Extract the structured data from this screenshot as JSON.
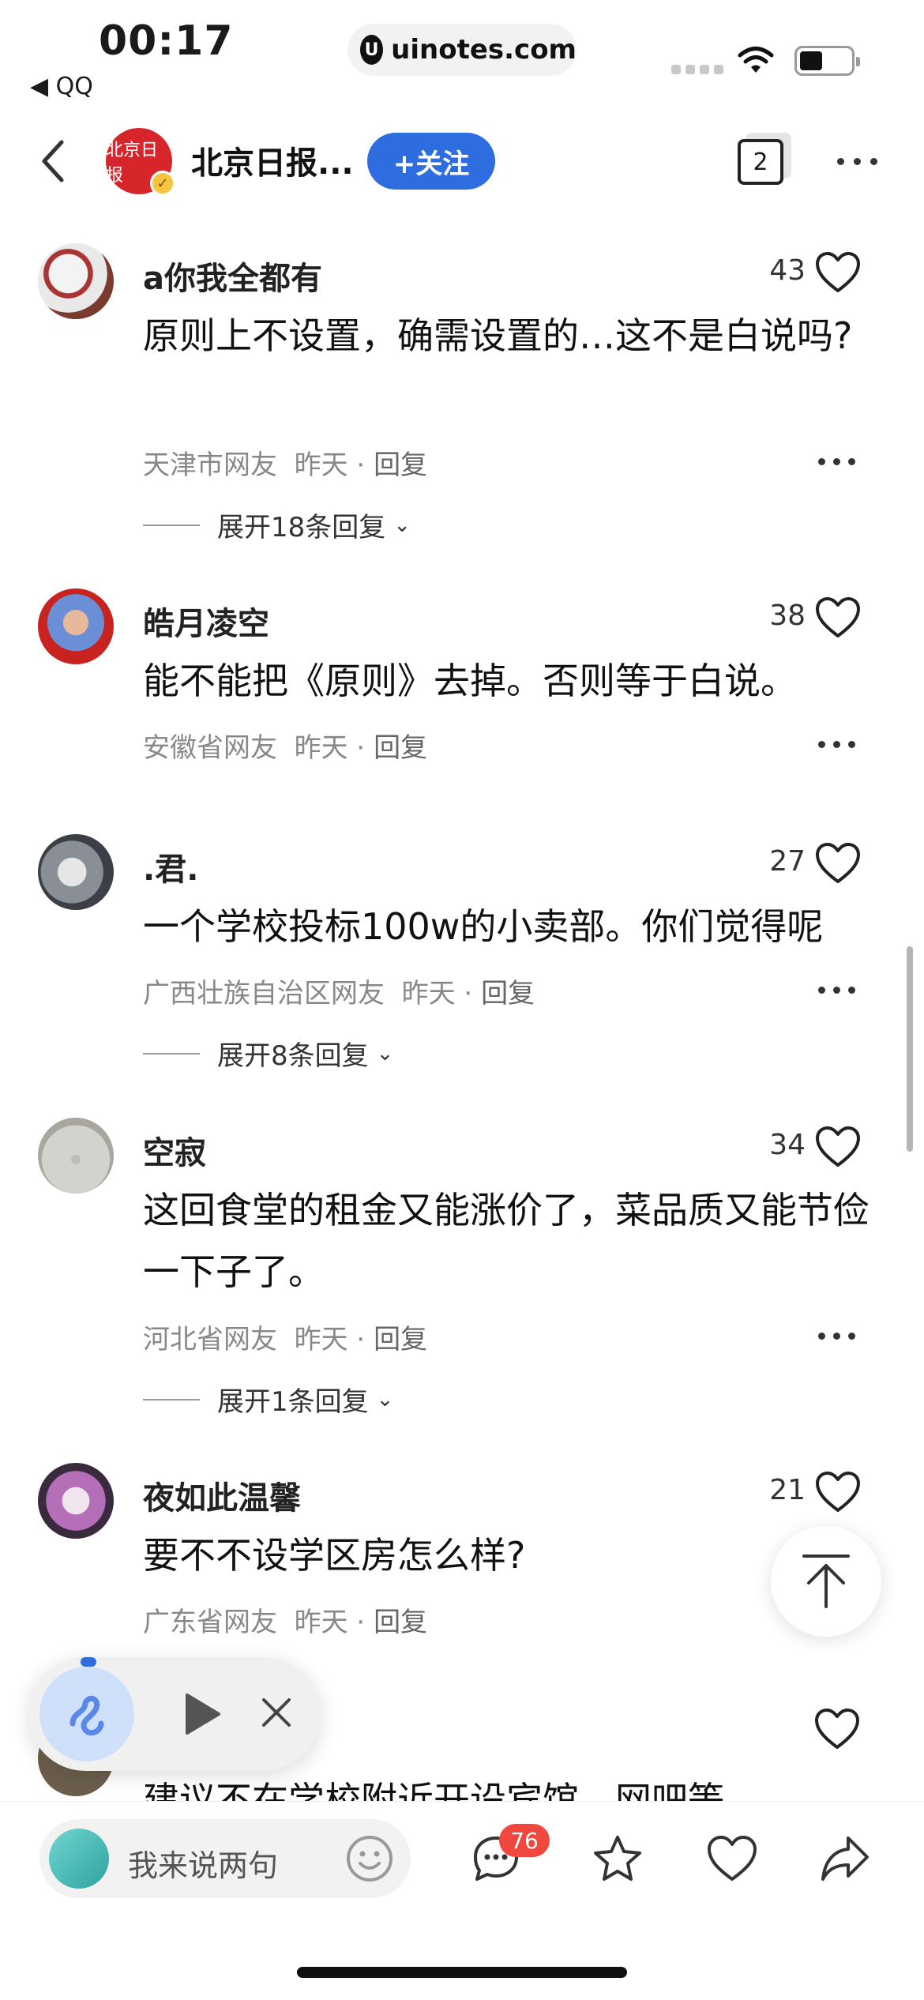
{
  "status_bar": {
    "time": "00:17",
    "back_app": "◀ QQ",
    "url": "uinotes.com",
    "url_logo": "U"
  },
  "header": {
    "avatar_text": "北京日报",
    "title": "北京日报...",
    "follow_label": "+关注",
    "tab_count": "2"
  },
  "comments": [
    {
      "name": "a你我全都有",
      "likes": "43",
      "text": "原则上不设置，确需设置的…这不是白说吗?",
      "location": "天津市网友",
      "time": "昨天",
      "reply_label": "回复",
      "expand_label": "展开18条回复"
    },
    {
      "name": "皓月凌空",
      "likes": "38",
      "text": "能不能把《原则》去掉。否则等于白说。",
      "location": "安徽省网友",
      "time": "昨天",
      "reply_label": "回复"
    },
    {
      "name": ".君.",
      "likes": "27",
      "text": "一个学校投标100w的小卖部。你们觉得呢",
      "location": "广西壮族自治区网友",
      "time": "昨天",
      "reply_label": "回复",
      "expand_label": "展开8条回复"
    },
    {
      "name": "空寂",
      "likes": "34",
      "text": "这回食堂的租金又能涨价了，菜品质又能节俭一下子了。",
      "location": "河北省网友",
      "time": "昨天",
      "reply_label": "回复",
      "expand_label": "展开1条回复"
    },
    {
      "name": "夜如此温馨",
      "likes": "21",
      "text": "要不不设学区房怎么样?",
      "location": "广东省网友",
      "time": "昨天",
      "reply_label": "回复"
    }
  ],
  "partial_comment": {
    "text": "建议不在学校附近开设宾馆，网吧等"
  },
  "bottom_bar": {
    "input_placeholder": "我来说两句",
    "comment_badge": "76"
  },
  "colors": {
    "accent_blue": "#2e6de0",
    "badge_red": "#f0473f",
    "brand_red": "#d7262b"
  },
  "icons": [
    "back-arrow-icon",
    "more-icon",
    "heart-icon",
    "chevron-down-icon",
    "arrow-up-icon",
    "play-icon",
    "close-icon",
    "emoji-icon",
    "comment-icon",
    "star-icon",
    "share-icon"
  ]
}
